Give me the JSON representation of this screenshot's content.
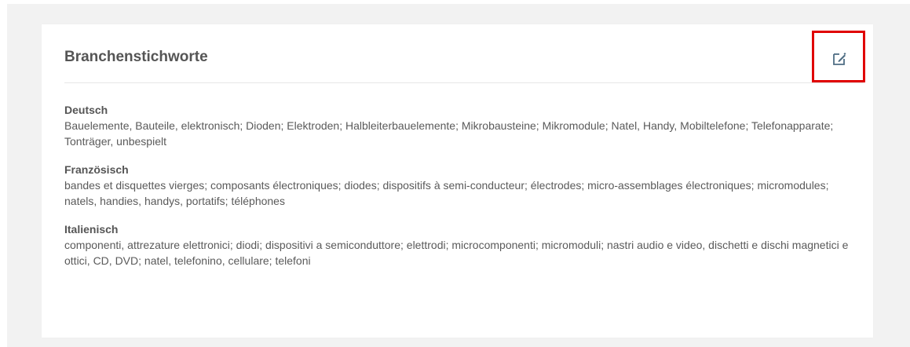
{
  "card": {
    "title": "Branchenstichworte",
    "edit_icon": "edit-pencil-square-icon"
  },
  "languages": [
    {
      "title": "Deutsch",
      "text": "Bauelemente, Bauteile, elektronisch; Dioden; Elektroden; Halbleiterbauelemente; Mikrobausteine; Mikromodule; Natel, Handy, Mobiltelefone; Telefonapparate; Tonträger, unbespielt"
    },
    {
      "title": "Französisch",
      "text": "bandes et disquettes vierges; composants électroniques; diodes; dispositifs à semi-conducteur; électrodes; micro-assemblages électroniques; micromodules; natels, handies, handys, portatifs; téléphones"
    },
    {
      "title": "Italienisch",
      "text": "componenti, attrezature elettronici; diodi; dispositivi a semiconduttore; elettrodi; microcomponenti; micromoduli; nastri audio e video, dischetti e dischi magnetici e ottici, CD, DVD; natel, telefonino, cellulare; telefoni"
    }
  ],
  "colors": {
    "highlight": "#e00000",
    "text": "#555555",
    "icon": "#4f6d84",
    "panel_bg": "#f2f2f2"
  }
}
